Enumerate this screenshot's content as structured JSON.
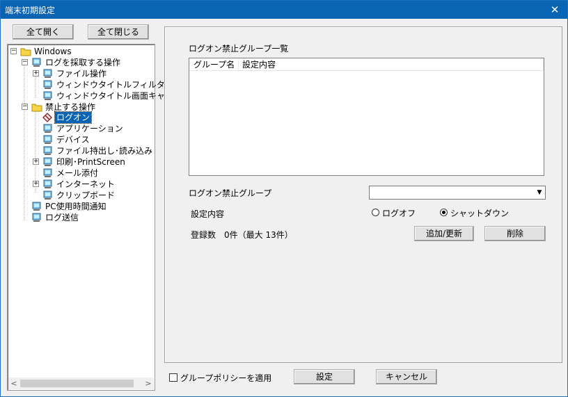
{
  "window": {
    "title": "端末初期設定",
    "close_symbol": "✕"
  },
  "left": {
    "expand_all": "全て開く",
    "collapse_all": "全て閉じる",
    "tree": [
      {
        "label": "Windows",
        "expander": "−",
        "icon": "folder-icon"
      },
      {
        "label": "ログを採取する操作",
        "expander": "−",
        "icon": "monitor-icon"
      },
      {
        "label": "ファイル操作",
        "expander": "+",
        "icon": "monitor-icon"
      },
      {
        "label": "ウィンドウタイトルフィルタ",
        "icon": "monitor-icon"
      },
      {
        "label": "ウィンドウタイトル画面キャ",
        "icon": "monitor-icon"
      },
      {
        "label": "禁止する操作",
        "expander": "−",
        "icon": "folder-icon"
      },
      {
        "label": "ログオン",
        "icon": "diamond-icon",
        "selected": true
      },
      {
        "label": "アプリケーション",
        "icon": "monitor-icon"
      },
      {
        "label": "デバイス",
        "icon": "monitor-icon"
      },
      {
        "label": "ファイル持出し･読み込み",
        "icon": "monitor-icon"
      },
      {
        "label": "印刷･PrintScreen",
        "expander": "+",
        "icon": "monitor-icon"
      },
      {
        "label": "メール添付",
        "icon": "monitor-icon"
      },
      {
        "label": "インターネット",
        "expander": "+",
        "icon": "monitor-icon"
      },
      {
        "label": "クリップボード",
        "icon": "monitor-icon"
      },
      {
        "label": "PC使用時間通知",
        "icon": "monitor-icon"
      },
      {
        "label": "ログ送信",
        "icon": "monitor-icon"
      }
    ],
    "scroll_left": "<",
    "scroll_right": ">"
  },
  "main": {
    "list_title": "ログオン禁止グループ一覧",
    "columns": [
      "グループ名",
      "設定内容"
    ],
    "group_label": "ログオン禁止グループ",
    "group_value": "",
    "combo_arrow": "▼",
    "setting_label": "設定内容",
    "radio_logoff": "ログオフ",
    "radio_shutdown": "シャットダウン",
    "registered": "登録数　0件（最大 13件）",
    "add_update": "追加/更新",
    "delete": "削除"
  },
  "footer": {
    "policy_checkbox": "グループポリシーを適用",
    "ok": "設定",
    "cancel": "キャンセル"
  },
  "colors": {
    "titlebar": "#0a64b4",
    "selection": "#0a64b4",
    "folder": "#f5d547"
  }
}
